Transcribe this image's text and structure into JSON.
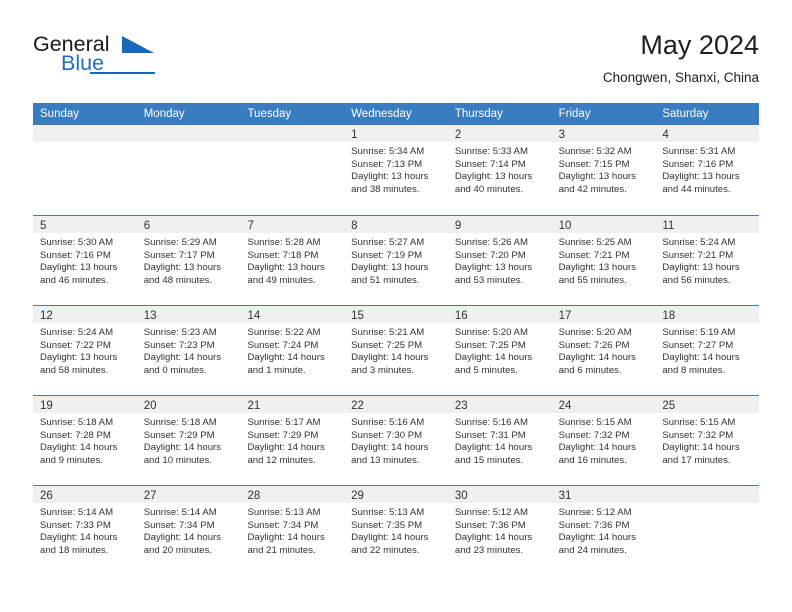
{
  "brand": {
    "word1": "General",
    "word2": "Blue",
    "accent_color": "#1668b8"
  },
  "header": {
    "title": "May 2024",
    "subtitle": "Chongwen, Shanxi, China"
  },
  "calendar": {
    "header_color": "#3a7cc0",
    "weekdays": [
      "Sunday",
      "Monday",
      "Tuesday",
      "Wednesday",
      "Thursday",
      "Friday",
      "Saturday"
    ],
    "weeks": [
      [
        {
          "day": "",
          "sunrise": "",
          "sunset": "",
          "daylight1": "",
          "daylight2": ""
        },
        {
          "day": "",
          "sunrise": "",
          "sunset": "",
          "daylight1": "",
          "daylight2": ""
        },
        {
          "day": "",
          "sunrise": "",
          "sunset": "",
          "daylight1": "",
          "daylight2": ""
        },
        {
          "day": "1",
          "sunrise": "Sunrise: 5:34 AM",
          "sunset": "Sunset: 7:13 PM",
          "daylight1": "Daylight: 13 hours",
          "daylight2": "and 38 minutes."
        },
        {
          "day": "2",
          "sunrise": "Sunrise: 5:33 AM",
          "sunset": "Sunset: 7:14 PM",
          "daylight1": "Daylight: 13 hours",
          "daylight2": "and 40 minutes."
        },
        {
          "day": "3",
          "sunrise": "Sunrise: 5:32 AM",
          "sunset": "Sunset: 7:15 PM",
          "daylight1": "Daylight: 13 hours",
          "daylight2": "and 42 minutes."
        },
        {
          "day": "4",
          "sunrise": "Sunrise: 5:31 AM",
          "sunset": "Sunset: 7:16 PM",
          "daylight1": "Daylight: 13 hours",
          "daylight2": "and 44 minutes."
        }
      ],
      [
        {
          "day": "5",
          "sunrise": "Sunrise: 5:30 AM",
          "sunset": "Sunset: 7:16 PM",
          "daylight1": "Daylight: 13 hours",
          "daylight2": "and 46 minutes."
        },
        {
          "day": "6",
          "sunrise": "Sunrise: 5:29 AM",
          "sunset": "Sunset: 7:17 PM",
          "daylight1": "Daylight: 13 hours",
          "daylight2": "and 48 minutes."
        },
        {
          "day": "7",
          "sunrise": "Sunrise: 5:28 AM",
          "sunset": "Sunset: 7:18 PM",
          "daylight1": "Daylight: 13 hours",
          "daylight2": "and 49 minutes."
        },
        {
          "day": "8",
          "sunrise": "Sunrise: 5:27 AM",
          "sunset": "Sunset: 7:19 PM",
          "daylight1": "Daylight: 13 hours",
          "daylight2": "and 51 minutes."
        },
        {
          "day": "9",
          "sunrise": "Sunrise: 5:26 AM",
          "sunset": "Sunset: 7:20 PM",
          "daylight1": "Daylight: 13 hours",
          "daylight2": "and 53 minutes."
        },
        {
          "day": "10",
          "sunrise": "Sunrise: 5:25 AM",
          "sunset": "Sunset: 7:21 PM",
          "daylight1": "Daylight: 13 hours",
          "daylight2": "and 55 minutes."
        },
        {
          "day": "11",
          "sunrise": "Sunrise: 5:24 AM",
          "sunset": "Sunset: 7:21 PM",
          "daylight1": "Daylight: 13 hours",
          "daylight2": "and 56 minutes."
        }
      ],
      [
        {
          "day": "12",
          "sunrise": "Sunrise: 5:24 AM",
          "sunset": "Sunset: 7:22 PM",
          "daylight1": "Daylight: 13 hours",
          "daylight2": "and 58 minutes."
        },
        {
          "day": "13",
          "sunrise": "Sunrise: 5:23 AM",
          "sunset": "Sunset: 7:23 PM",
          "daylight1": "Daylight: 14 hours",
          "daylight2": "and 0 minutes."
        },
        {
          "day": "14",
          "sunrise": "Sunrise: 5:22 AM",
          "sunset": "Sunset: 7:24 PM",
          "daylight1": "Daylight: 14 hours",
          "daylight2": "and 1 minute."
        },
        {
          "day": "15",
          "sunrise": "Sunrise: 5:21 AM",
          "sunset": "Sunset: 7:25 PM",
          "daylight1": "Daylight: 14 hours",
          "daylight2": "and 3 minutes."
        },
        {
          "day": "16",
          "sunrise": "Sunrise: 5:20 AM",
          "sunset": "Sunset: 7:25 PM",
          "daylight1": "Daylight: 14 hours",
          "daylight2": "and 5 minutes."
        },
        {
          "day": "17",
          "sunrise": "Sunrise: 5:20 AM",
          "sunset": "Sunset: 7:26 PM",
          "daylight1": "Daylight: 14 hours",
          "daylight2": "and 6 minutes."
        },
        {
          "day": "18",
          "sunrise": "Sunrise: 5:19 AM",
          "sunset": "Sunset: 7:27 PM",
          "daylight1": "Daylight: 14 hours",
          "daylight2": "and 8 minutes."
        }
      ],
      [
        {
          "day": "19",
          "sunrise": "Sunrise: 5:18 AM",
          "sunset": "Sunset: 7:28 PM",
          "daylight1": "Daylight: 14 hours",
          "daylight2": "and 9 minutes."
        },
        {
          "day": "20",
          "sunrise": "Sunrise: 5:18 AM",
          "sunset": "Sunset: 7:29 PM",
          "daylight1": "Daylight: 14 hours",
          "daylight2": "and 10 minutes."
        },
        {
          "day": "21",
          "sunrise": "Sunrise: 5:17 AM",
          "sunset": "Sunset: 7:29 PM",
          "daylight1": "Daylight: 14 hours",
          "daylight2": "and 12 minutes."
        },
        {
          "day": "22",
          "sunrise": "Sunrise: 5:16 AM",
          "sunset": "Sunset: 7:30 PM",
          "daylight1": "Daylight: 14 hours",
          "daylight2": "and 13 minutes."
        },
        {
          "day": "23",
          "sunrise": "Sunrise: 5:16 AM",
          "sunset": "Sunset: 7:31 PM",
          "daylight1": "Daylight: 14 hours",
          "daylight2": "and 15 minutes."
        },
        {
          "day": "24",
          "sunrise": "Sunrise: 5:15 AM",
          "sunset": "Sunset: 7:32 PM",
          "daylight1": "Daylight: 14 hours",
          "daylight2": "and 16 minutes."
        },
        {
          "day": "25",
          "sunrise": "Sunrise: 5:15 AM",
          "sunset": "Sunset: 7:32 PM",
          "daylight1": "Daylight: 14 hours",
          "daylight2": "and 17 minutes."
        }
      ],
      [
        {
          "day": "26",
          "sunrise": "Sunrise: 5:14 AM",
          "sunset": "Sunset: 7:33 PM",
          "daylight1": "Daylight: 14 hours",
          "daylight2": "and 18 minutes."
        },
        {
          "day": "27",
          "sunrise": "Sunrise: 5:14 AM",
          "sunset": "Sunset: 7:34 PM",
          "daylight1": "Daylight: 14 hours",
          "daylight2": "and 20 minutes."
        },
        {
          "day": "28",
          "sunrise": "Sunrise: 5:13 AM",
          "sunset": "Sunset: 7:34 PM",
          "daylight1": "Daylight: 14 hours",
          "daylight2": "and 21 minutes."
        },
        {
          "day": "29",
          "sunrise": "Sunrise: 5:13 AM",
          "sunset": "Sunset: 7:35 PM",
          "daylight1": "Daylight: 14 hours",
          "daylight2": "and 22 minutes."
        },
        {
          "day": "30",
          "sunrise": "Sunrise: 5:12 AM",
          "sunset": "Sunset: 7:36 PM",
          "daylight1": "Daylight: 14 hours",
          "daylight2": "and 23 minutes."
        },
        {
          "day": "31",
          "sunrise": "Sunrise: 5:12 AM",
          "sunset": "Sunset: 7:36 PM",
          "daylight1": "Daylight: 14 hours",
          "daylight2": "and 24 minutes."
        },
        {
          "day": "",
          "sunrise": "",
          "sunset": "",
          "daylight1": "",
          "daylight2": ""
        }
      ]
    ]
  }
}
